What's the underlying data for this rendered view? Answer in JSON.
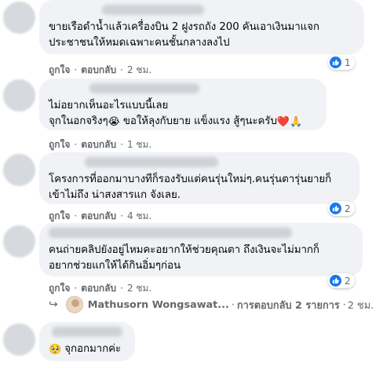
{
  "comments": [
    {
      "text": "ขายเรือดำน้ำแล้วเครื่องบิน 2 ฝูงรถถัง 200 คันเอาเงินมาแจก\nประชาชนให้หมดเฉพาะคนชั้นกลางลงไป",
      "like_label": "ถูกใจ",
      "reply_label": "ตอบกลับ",
      "time": "2 ชม.",
      "reaction_count": "1"
    },
    {
      "text_line1": "ไม่อยากเห็นอะไรแบบนี้เลย",
      "text_line2_a": "จุกในอกจริงๆ",
      "emoji_cry": "😭",
      "text_line2_b": " ขอให้ลุงกับยาย แข็งแรง สู้ๆนะครับ",
      "emoji_heart": "❤️",
      "emoji_pray": "🙏",
      "like_label": "ถูกใจ",
      "reply_label": "ตอบกลับ",
      "time": "1 ชม."
    },
    {
      "text": "โครงการที่ออกมาบางทีก็รองรับแต่คนรุ่นใหม่ๆ.คนรุ่นตารุ่นยายก็\nเข้าไม่ถึง น่าสงสารแก จังเลย.",
      "like_label": "ถูกใจ",
      "reply_label": "ตอบกลับ",
      "time": "4 ชม.",
      "reaction_count": "2"
    },
    {
      "text": "คนถ่ายคลิปยังอยู่ไหมคะอยากให้ช่วยคุณตา ถึงเงินจะไม่มากก็\nอยากช่วยแกให้ได้กินอิ่มๆก่อน",
      "like_label": "ถูกใจ",
      "reply_label": "ตอบกลับ",
      "time": "2 ชม.",
      "reaction_count": "2"
    },
    {
      "emoji_pleading": "🥺",
      "text": " จุกอกมากค่ะ"
    }
  ],
  "reply_preview": {
    "arrow": "↪",
    "name": "Mathusorn Wongsawat...",
    "dot": "·",
    "count_label": "การตอบกลับ 2 รายการ",
    "time": "2 ชม."
  },
  "separator": "·",
  "colors": {
    "bubble": "#f0f2f5",
    "meta": "#65676b",
    "like_blue": "#1877f2"
  },
  "icons": {
    "like": "like-icon",
    "reply_arrow": "reply-arrow-icon"
  }
}
